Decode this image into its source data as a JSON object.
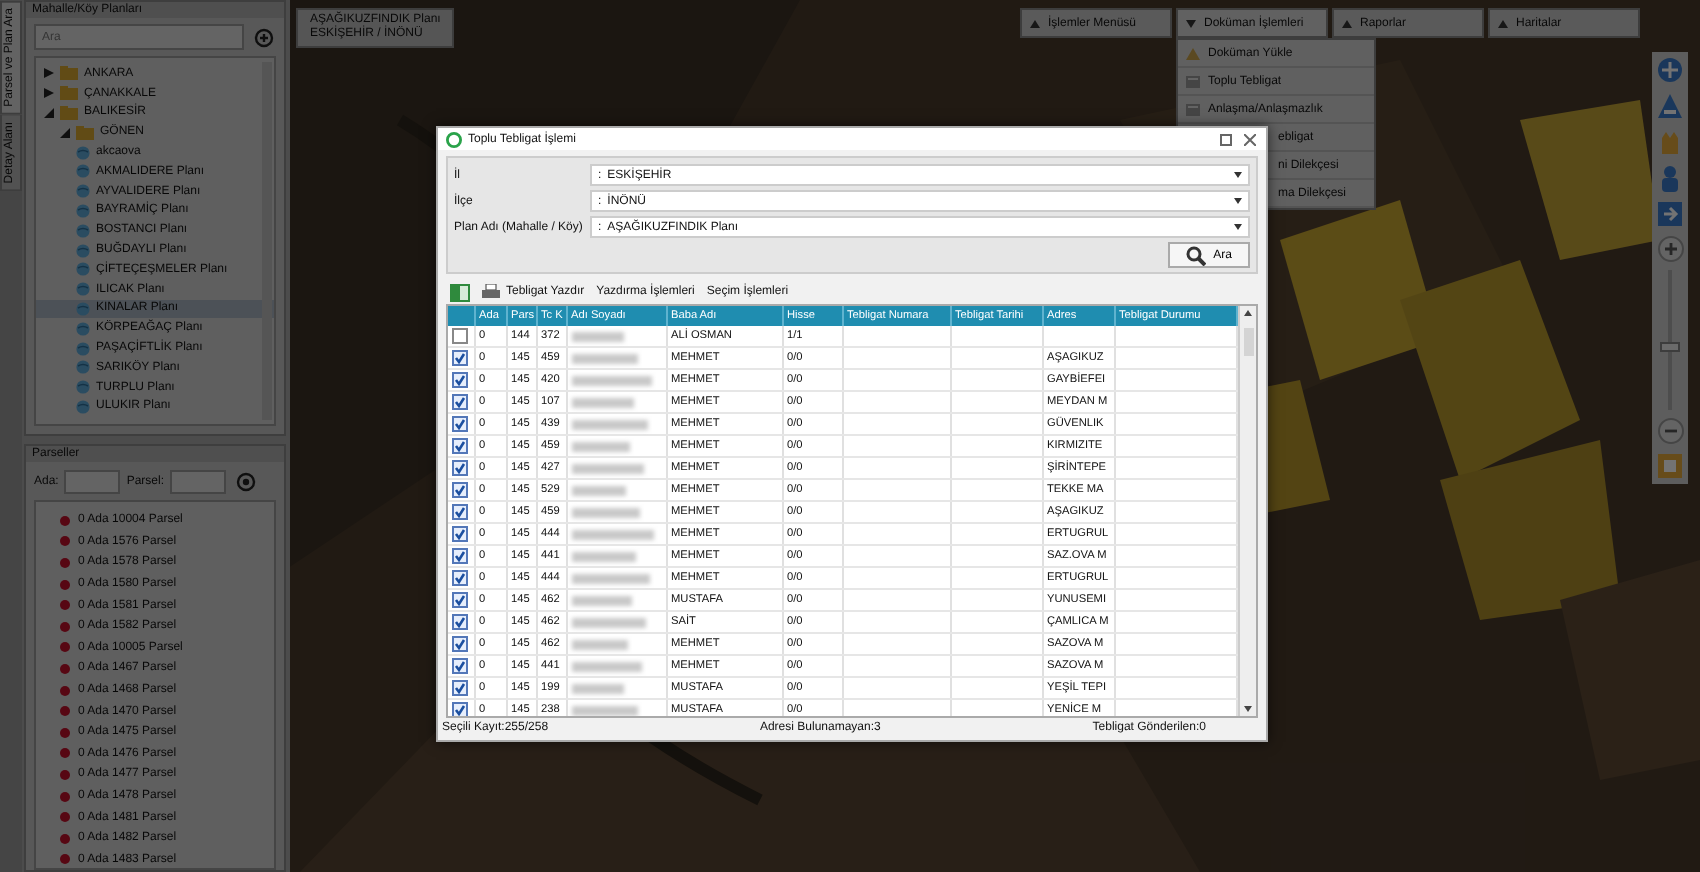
{
  "side_tabs": [
    {
      "label": "Detay Alanı",
      "selected": false
    },
    {
      "label": "Parsel ve Plan Ara",
      "selected": true
    }
  ],
  "plans_panel": {
    "title": "Mahalle/Köy Planları",
    "search": {
      "placeholder": "Ara"
    },
    "tree": [
      {
        "label": "ANKARA",
        "kind": "folder",
        "expanded": false,
        "selected": false
      },
      {
        "label": "ÇANAKKALE",
        "kind": "folder",
        "expanded": false,
        "selected": false
      },
      {
        "label": "BALIKESİR",
        "kind": "folder",
        "expanded": true,
        "selected": false,
        "children": [
          {
            "label": "GÖNEN",
            "kind": "folder",
            "expanded": true,
            "selected": false,
            "children": [
              {
                "label": "akcaova",
                "kind": "plan",
                "selected": false
              },
              {
                "label": "AKMALIDERE Planı",
                "kind": "plan",
                "selected": false
              },
              {
                "label": "AYVALIDERE Planı",
                "kind": "plan",
                "selected": false
              },
              {
                "label": "BAYRAMİÇ Planı",
                "kind": "plan",
                "selected": false
              },
              {
                "label": "BOSTANCI Planı",
                "kind": "plan",
                "selected": false
              },
              {
                "label": "BUĞDAYLI Planı",
                "kind": "plan",
                "selected": false
              },
              {
                "label": "ÇİFTEÇEŞMELER Planı",
                "kind": "plan",
                "selected": false
              },
              {
                "label": "ILICAK Planı",
                "kind": "plan",
                "selected": false
              },
              {
                "label": "KINALAR Planı",
                "kind": "plan",
                "selected": true
              },
              {
                "label": "KÖRPEAĞAÇ Planı",
                "kind": "plan",
                "selected": false
              },
              {
                "label": "PAŞAÇİFTLİK Planı",
                "kind": "plan",
                "selected": false
              },
              {
                "label": "SARIKÖY Planı",
                "kind": "plan",
                "selected": false
              },
              {
                "label": "TURPLU Planı",
                "kind": "plan",
                "selected": false
              },
              {
                "label": "ULUKIR Planı",
                "kind": "plan",
                "selected": false
              }
            ]
          }
        ]
      }
    ]
  },
  "parcels_panel": {
    "title": "Parseller",
    "ada_label": "Ada:",
    "parsel_label": "Parsel:",
    "items": [
      "0 Ada 10004 Parsel",
      "0 Ada 1576 Parsel",
      "0 Ada 1578 Parsel",
      "0 Ada 1580 Parsel",
      "0 Ada 1581 Parsel",
      "0 Ada 1582 Parsel",
      "0 Ada 10005 Parsel",
      "0 Ada 1467 Parsel",
      "0 Ada 1468 Parsel",
      "0 Ada 1470 Parsel",
      "0 Ada 1475 Parsel",
      "0 Ada 1476 Parsel",
      "0 Ada 1477 Parsel",
      "0 Ada 1478 Parsel",
      "0 Ada 1481 Parsel",
      "0 Ada 1482 Parsel",
      "0 Ada 1483 Parsel"
    ]
  },
  "breadcrumb": {
    "title": "AŞAĞIKUZFINDIK Planı",
    "subtitle": "ESKİŞEHİR / İNÖNÜ"
  },
  "menus": [
    {
      "label": "İşlemler Menüsü",
      "expanded": false
    },
    {
      "label": "Doküman İşlemleri",
      "expanded": true,
      "items": [
        {
          "label": "Doküman Yükle",
          "kind": "upload"
        },
        {
          "label": "Toplu Tebligat",
          "kind": "document"
        },
        {
          "label": "Anlaşma/Anlaşmazlık",
          "kind": "document"
        },
        {
          "label": "ebligat",
          "kind": "covered"
        },
        {
          "label": "ni Dilekçesi",
          "kind": "covered"
        },
        {
          "label": "ma Dilekçesi",
          "kind": "covered"
        }
      ]
    },
    {
      "label": "Raporlar",
      "expanded": false
    },
    {
      "label": "Haritalar",
      "expanded": false
    }
  ],
  "zoom": {
    "level": 0.45
  },
  "dialog": {
    "title": "Toplu Tebligat İşlemi",
    "fields": [
      {
        "label": "İl",
        "separator": ":",
        "value": "ESKİŞEHİR"
      },
      {
        "label": "İlçe",
        "separator": ":",
        "value": "İNÖNÜ"
      },
      {
        "label": "Plan Adı (Mahalle / Köy)",
        "separator": ":",
        "value": "AŞAĞIKUZFINDIK Planı"
      }
    ],
    "search_button": "Ara",
    "toolbar": [
      "Tebligat Yazdır",
      "Yazdırma İşlemleri",
      "Seçim İşlemleri"
    ],
    "columns": [
      "Ada",
      "Pars",
      "Tc K",
      "Adı Soyadı",
      "Baba Adı",
      "Hisse",
      "Tebligat Numara",
      "Tebligat Tarihi",
      "Adres",
      "Tebligat Durumu"
    ],
    "rows": [
      {
        "checked": false,
        "ada": "0",
        "parsel": "144",
        "tc": "372",
        "name_hidden": true,
        "father": "ALİ OSMAN",
        "share": "1/1",
        "address": ""
      },
      {
        "checked": true,
        "ada": "0",
        "parsel": "145",
        "tc": "459",
        "name_hidden": true,
        "father": "MEHMET",
        "share": "0/0",
        "address": "AŞAGIKUZ"
      },
      {
        "checked": true,
        "ada": "0",
        "parsel": "145",
        "tc": "420",
        "name_hidden": true,
        "father": "MEHMET",
        "share": "0/0",
        "address": "GAYBİEFEI"
      },
      {
        "checked": true,
        "ada": "0",
        "parsel": "145",
        "tc": "107",
        "name_hidden": true,
        "father": "MEHMET",
        "share": "0/0",
        "address": "MEYDAN M"
      },
      {
        "checked": true,
        "ada": "0",
        "parsel": "145",
        "tc": "439",
        "name_hidden": true,
        "father": "MEHMET",
        "share": "0/0",
        "address": "GÜVENLIK"
      },
      {
        "checked": true,
        "ada": "0",
        "parsel": "145",
        "tc": "459",
        "name_hidden": true,
        "father": "MEHMET",
        "share": "0/0",
        "address": "KIRMIZITE"
      },
      {
        "checked": true,
        "ada": "0",
        "parsel": "145",
        "tc": "427",
        "name_hidden": true,
        "father": "MEHMET",
        "share": "0/0",
        "address": "ŞİRİNTEPE"
      },
      {
        "checked": true,
        "ada": "0",
        "parsel": "145",
        "tc": "529",
        "name_hidden": true,
        "father": "MEHMET",
        "share": "0/0",
        "address": "TEKKE MA"
      },
      {
        "checked": true,
        "ada": "0",
        "parsel": "145",
        "tc": "459",
        "name_hidden": true,
        "father": "MEHMET",
        "share": "0/0",
        "address": "AŞAGIKUZ"
      },
      {
        "checked": true,
        "ada": "0",
        "parsel": "145",
        "tc": "444",
        "name_hidden": true,
        "father": "MEHMET",
        "share": "0/0",
        "address": "ERTUGRUL"
      },
      {
        "checked": true,
        "ada": "0",
        "parsel": "145",
        "tc": "441",
        "name_hidden": true,
        "father": "MEHMET",
        "share": "0/0",
        "address": "SAZ.OVA M"
      },
      {
        "checked": true,
        "ada": "0",
        "parsel": "145",
        "tc": "444",
        "name_hidden": true,
        "father": "MEHMET",
        "share": "0/0",
        "address": "ERTUGRUL"
      },
      {
        "checked": true,
        "ada": "0",
        "parsel": "145",
        "tc": "462",
        "name_hidden": true,
        "father": "MUSTAFA",
        "share": "0/0",
        "address": "YUNUSEMI"
      },
      {
        "checked": true,
        "ada": "0",
        "parsel": "145",
        "tc": "462",
        "name_hidden": true,
        "father": "SAİT",
        "share": "0/0",
        "address": "ÇAMLICA M"
      },
      {
        "checked": true,
        "ada": "0",
        "parsel": "145",
        "tc": "462",
        "name_hidden": true,
        "father": "MEHMET",
        "share": "0/0",
        "address": "SAZOVA M"
      },
      {
        "checked": true,
        "ada": "0",
        "parsel": "145",
        "tc": "441",
        "name_hidden": true,
        "father": "MEHMET",
        "share": "0/0",
        "address": "SAZOVA M"
      },
      {
        "checked": true,
        "ada": "0",
        "parsel": "145",
        "tc": "199",
        "name_hidden": true,
        "father": "MUSTAFA",
        "share": "0/0",
        "address": "YEŞİL TEPI"
      },
      {
        "checked": true,
        "ada": "0",
        "parsel": "145",
        "tc": "238",
        "name_hidden": true,
        "father": "MUSTAFA",
        "share": "0/0",
        "address": "YENİCE M"
      }
    ],
    "footer": [
      "Seçili Kayıt:255/258",
      "Adresi Bulunamayan:3",
      "Tebligat Gönderilen:0"
    ]
  }
}
